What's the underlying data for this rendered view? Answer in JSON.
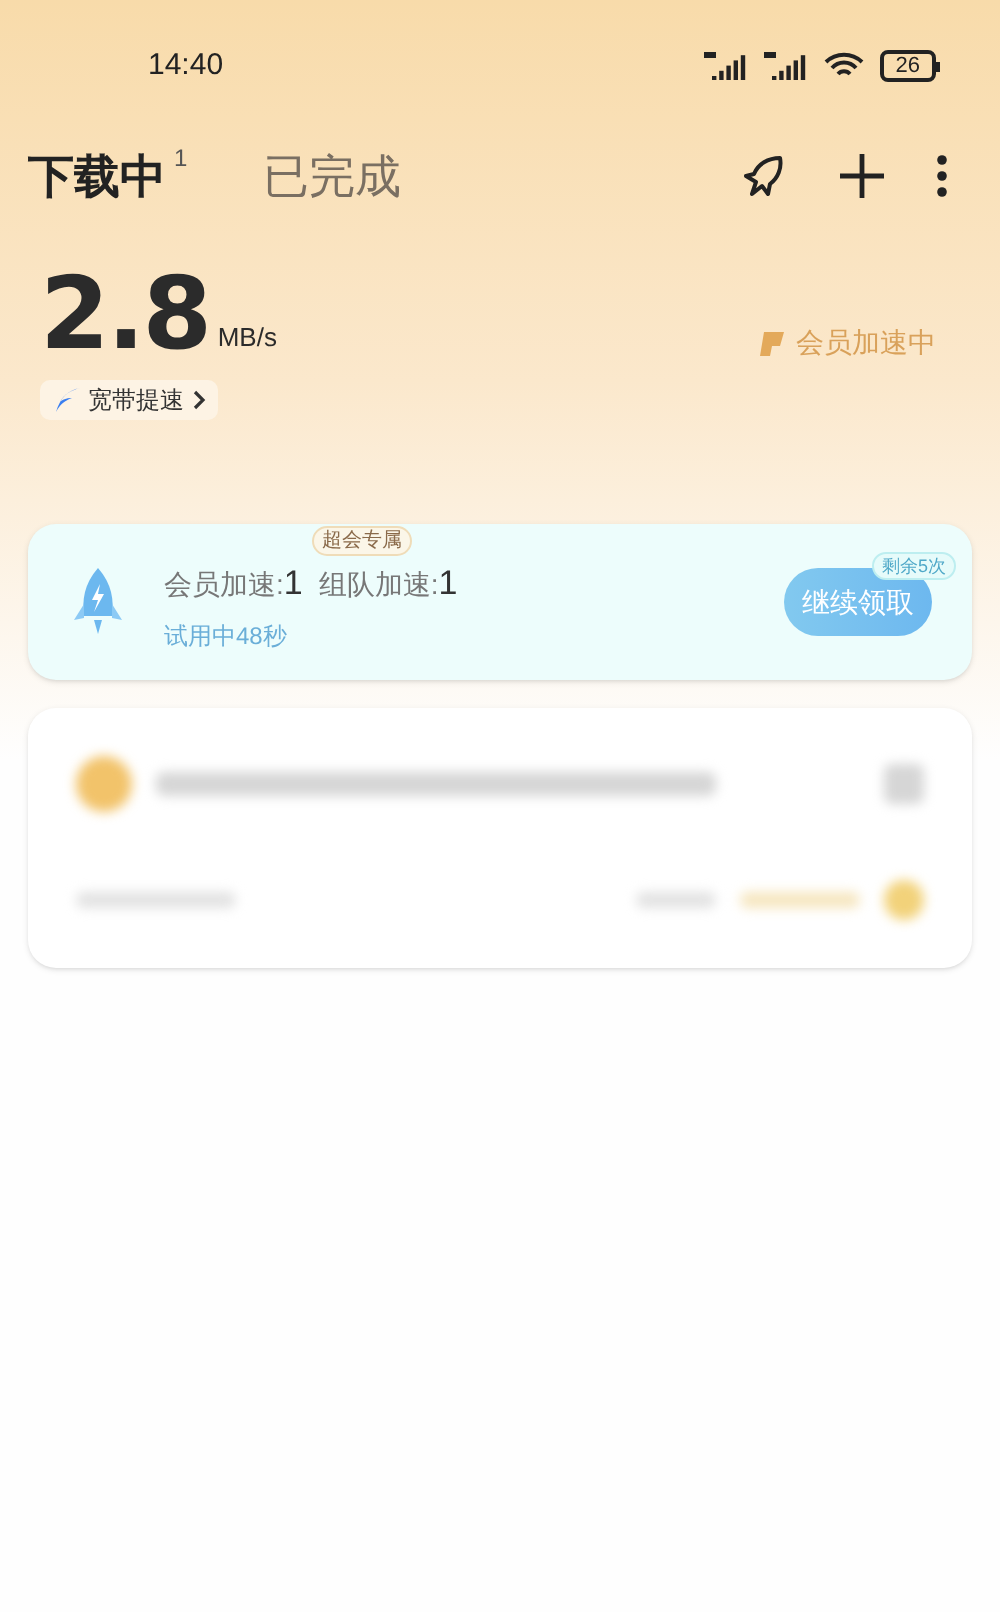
{
  "status_bar": {
    "time": "14:40",
    "battery": "26"
  },
  "tabs": [
    {
      "label": "下载中",
      "badge": "1",
      "selected": true
    },
    {
      "label": "已完成",
      "selected": false
    }
  ],
  "speed": {
    "value": "2.8",
    "unit": "MB/s",
    "broadband_link": "宽带提速",
    "vip_status": "会员加速中"
  },
  "boost_card": {
    "tag": "超会专属",
    "vip_label": "会员加速:",
    "vip_count": "1",
    "team_label": "组队加速:",
    "team_count": "1",
    "trial": "试用中48秒",
    "button": "继续领取",
    "remaining": "剩余5次"
  },
  "task_card": {
    "kind": "blurred"
  }
}
